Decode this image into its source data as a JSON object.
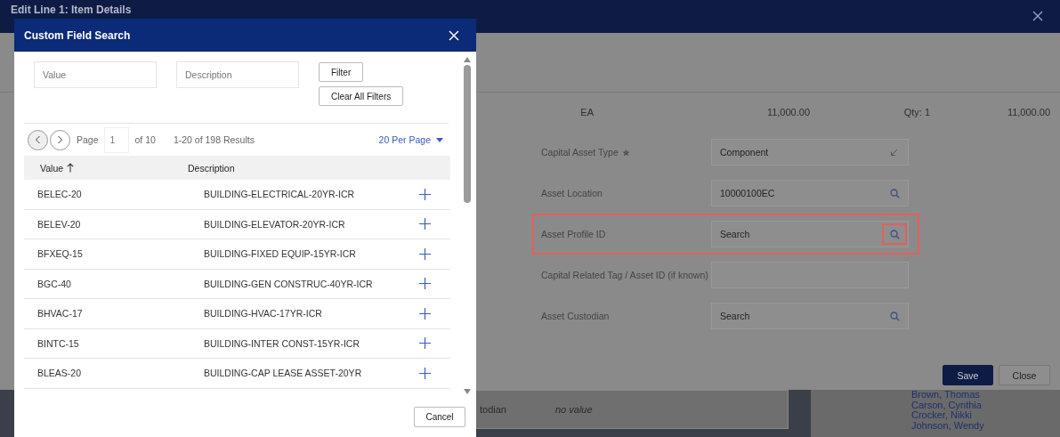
{
  "item_details_dialog": {
    "title": "Edit Line 1: Item Details",
    "summary": [
      "EA",
      "11,000.00",
      "Qty: 1",
      "11,000.00"
    ],
    "fields": [
      {
        "label": "Capital Asset Type",
        "required": true,
        "kind": "select",
        "value": "Component",
        "highlighted": false
      },
      {
        "label": "Asset Location",
        "required": false,
        "kind": "search",
        "value": "10000100EC",
        "highlighted": false
      },
      {
        "label": "Asset Profile ID",
        "required": false,
        "kind": "search",
        "placeholder": "Search",
        "highlighted": true
      },
      {
        "label": "Capital Related Tag / Asset ID (if known)",
        "required": false,
        "kind": "text",
        "highlighted": false
      },
      {
        "label": "Asset Custodian",
        "required": false,
        "kind": "search",
        "placeholder": "Search",
        "highlighted": false
      }
    ],
    "buttons": [
      {
        "label": "Save",
        "kind": "primary"
      },
      {
        "label": "Close",
        "kind": "secondary"
      }
    ]
  },
  "background_page": {
    "field_label": "todian",
    "field_value": "no value",
    "names": [
      "Brown, Thomas",
      "Carson, Cynthia",
      "Crocker, Nikki",
      "Johnson, Wendy"
    ]
  },
  "custom_field_search": {
    "title": "Custom Field Search",
    "filters": [
      {
        "placeholder": "Value"
      },
      {
        "placeholder": "Description"
      }
    ],
    "filter_button": "Filter",
    "clear_button": "Clear All Filters",
    "pagination": {
      "page_label": "Page",
      "page": "1",
      "page_count": "of 10",
      "results": "1-20 of 198 Results",
      "per_page": "20 Per Page"
    },
    "columns": [
      {
        "label": "Value",
        "sorted": true
      },
      {
        "label": "Description",
        "sorted": false
      }
    ],
    "rows": [
      {
        "value": "BELEC-20",
        "description": "BUILDING-ELECTRICAL-20YR-ICR"
      },
      {
        "value": "BELEV-20",
        "description": "BUILDING-ELEVATOR-20YR-ICR"
      },
      {
        "value": "BFXEQ-15",
        "description": "BUILDING-FIXED EQUIP-15YR-ICR"
      },
      {
        "value": "BGC-40",
        "description": "BUILDING-GEN CONSTRUC-40YR-ICR"
      },
      {
        "value": "BHVAC-17",
        "description": "BUILDING-HVAC-17YR-ICR"
      },
      {
        "value": "BINTC-15",
        "description": "BUILDING-INTER CONST-15YR-ICR"
      },
      {
        "value": "BLEAS-20",
        "description": "BUILDING-CAP LEASE ASSET-20YR"
      }
    ],
    "cancel_button": "Cancel"
  }
}
